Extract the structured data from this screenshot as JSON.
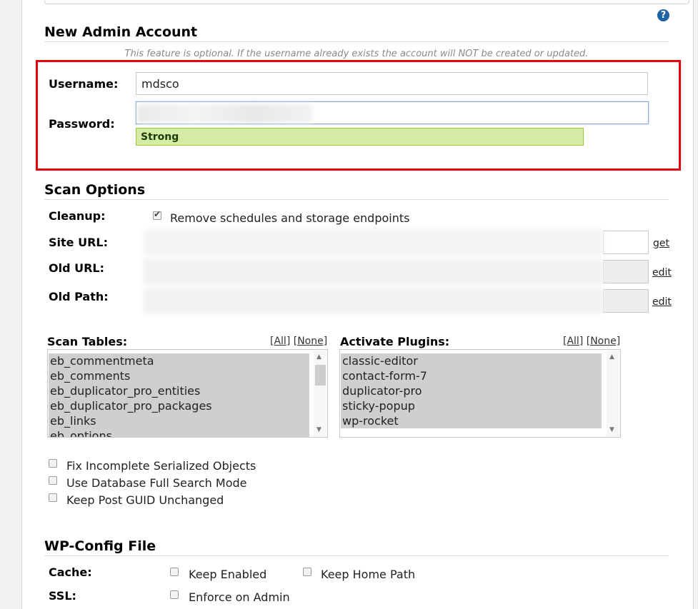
{
  "admin": {
    "title": "New Admin Account",
    "note": "This feature is optional. If the username already exists the account will NOT be created or updated.",
    "username_label": "Username:",
    "username_value": "mdsco",
    "password_label": "Password:",
    "strength": "Strong"
  },
  "scan": {
    "title": "Scan Options",
    "cleanup_label": "Cleanup:",
    "cleanup_option": "Remove schedules and storage endpoints",
    "cleanup_checked": true,
    "site_url_label": "Site URL:",
    "old_url_label": "Old URL:",
    "old_path_label": "Old Path:",
    "get_link": "get",
    "edit_link": "edit",
    "tables_label": "Scan Tables:",
    "plugins_label": "Activate Plugins:",
    "all_link": "[All]",
    "none_link": "[None]",
    "tables": [
      "eb_commentmeta",
      "eb_comments",
      "eb_duplicator_pro_entities",
      "eb_duplicator_pro_packages",
      "eb_links",
      "eb_options"
    ],
    "plugins": [
      "classic-editor",
      "contact-form-7",
      "duplicator-pro",
      "sticky-popup",
      "wp-rocket"
    ],
    "options": [
      "Fix Incomplete Serialized Objects",
      "Use Database Full Search Mode",
      "Keep Post GUID Unchanged"
    ]
  },
  "wpconfig": {
    "title": "WP-Config File",
    "cache_label": "Cache:",
    "keep_enabled": "Keep Enabled",
    "keep_home_path": "Keep Home Path",
    "ssl_label": "SSL:",
    "enforce_admin": "Enforce on Admin"
  },
  "icons": {
    "help": "question-circle-icon"
  },
  "colors": {
    "highlight_border": "#e8000b",
    "strength_bg": "#d3eba3",
    "help_icon": "#1f62a5"
  }
}
